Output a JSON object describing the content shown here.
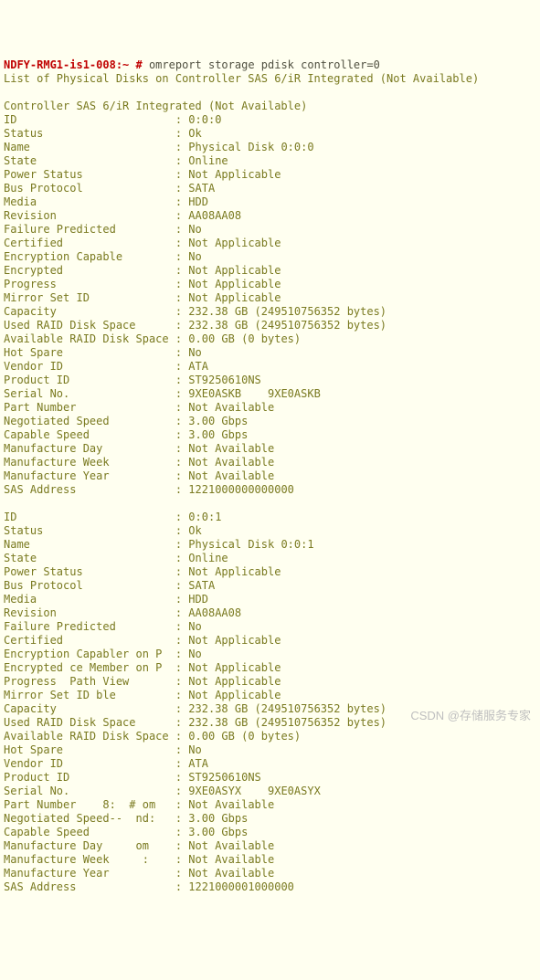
{
  "prompt": "NDFY-RMG1-is1-008:~ #",
  "command": "omreport storage pdisk controller=0",
  "header": "List of Physical Disks on Controller SAS 6/iR Integrated (Not Available)",
  "section": "Controller SAS 6/iR Integrated (Not Available)",
  "kv_width": 26,
  "disks": [
    {
      "rows": [
        [
          "ID",
          "0:0:0"
        ],
        [
          "Status",
          "Ok"
        ],
        [
          "Name",
          "Physical Disk 0:0:0"
        ],
        [
          "State",
          "Online"
        ],
        [
          "Power Status",
          "Not Applicable"
        ],
        [
          "Bus Protocol",
          "SATA"
        ],
        [
          "Media",
          "HDD"
        ],
        [
          "Revision",
          "AA08AA08"
        ],
        [
          "Failure Predicted",
          "No"
        ],
        [
          "Certified",
          "Not Applicable"
        ],
        [
          "Encryption Capable",
          "No"
        ],
        [
          "Encrypted",
          "Not Applicable"
        ],
        [
          "Progress",
          "Not Applicable"
        ],
        [
          "Mirror Set ID",
          "Not Applicable"
        ],
        [
          "Capacity",
          "232.38 GB (249510756352 bytes)"
        ],
        [
          "Used RAID Disk Space",
          "232.38 GB (249510756352 bytes)"
        ],
        [
          "Available RAID Disk Space",
          "0.00 GB (0 bytes)"
        ],
        [
          "Hot Spare",
          "No"
        ],
        [
          "Vendor ID",
          "ATA"
        ],
        [
          "Product ID",
          "ST9250610NS"
        ],
        [
          "Serial No.",
          "9XE0ASKB    9XE0ASKB"
        ],
        [
          "Part Number",
          "Not Available"
        ],
        [
          "Negotiated Speed",
          "3.00 Gbps"
        ],
        [
          "Capable Speed",
          "3.00 Gbps"
        ],
        [
          "Manufacture Day",
          "Not Available"
        ],
        [
          "Manufacture Week",
          "Not Available"
        ],
        [
          "Manufacture Year",
          "Not Available"
        ],
        [
          "SAS Address",
          "1221000000000000"
        ]
      ]
    },
    {
      "rows": [
        [
          "ID",
          "0:0:1"
        ],
        [
          "Status",
          "Ok"
        ],
        [
          "Name",
          "Physical Disk 0:0:1"
        ],
        [
          "State",
          "Online"
        ],
        [
          "Power Status",
          "Not Applicable"
        ],
        [
          "Bus Protocol",
          "SATA"
        ],
        [
          "Media",
          "HDD"
        ],
        [
          "Revision",
          "AA08AA08"
        ],
        [
          "Failure Predicted",
          "No"
        ],
        [
          "Certified",
          "Not Applicable"
        ],
        [
          "Encryption Capabler on P",
          "No"
        ],
        [
          "Encrypted ce Member on P",
          "Not Applicable"
        ],
        [
          "Progress  Path View",
          "Not Applicable"
        ],
        [
          "Mirror Set ID ble",
          "Not Applicable"
        ],
        [
          "Capacity",
          "232.38 GB (249510756352 bytes)"
        ],
        [
          "Used RAID Disk Space",
          "232.38 GB (249510756352 bytes)"
        ],
        [
          "Available RAID Disk Space",
          "0.00 GB (0 bytes)"
        ],
        [
          "Hot Spare",
          "No"
        ],
        [
          "Vendor ID",
          "ATA"
        ],
        [
          "Product ID",
          "ST9250610NS"
        ],
        [
          "Serial No.",
          "9XE0ASYX    9XE0ASYX"
        ],
        [
          "Part Number    8:  # om",
          "Not Available"
        ],
        [
          "Negotiated Speed--  nd:",
          "3.00 Gbps"
        ],
        [
          "Capable Speed",
          "3.00 Gbps"
        ],
        [
          "Manufacture Day     om",
          "Not Available"
        ],
        [
          "Manufacture Week     :",
          "Not Available"
        ],
        [
          "Manufacture Year",
          "Not Available"
        ],
        [
          "SAS Address",
          "1221000001000000"
        ]
      ]
    }
  ],
  "watermark": "CSDN @存储服务专家"
}
